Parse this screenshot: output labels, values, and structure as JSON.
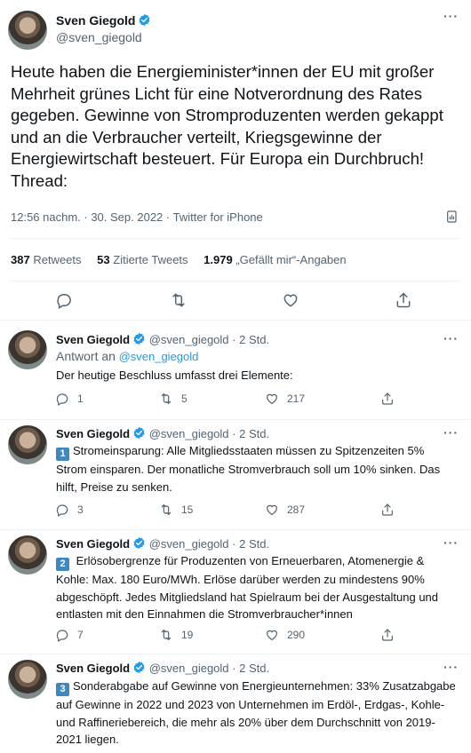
{
  "main_tweet": {
    "author_name": "Sven Giegold",
    "author_handle": "@sven_giegold",
    "text": "Heute haben die Energieminister*innen der EU mit großer Mehrheit grünes Licht für eine Notverordnung des Rates gegeben. Gewinne von Stromproduzenten werden gekappt und an die Verbraucher verteilt, Kriegsgewinne der Energiewirtschaft besteuert. Für Europa ein Durchbruch! Thread:",
    "timestamp": "12:56 nachm. · 30. Sep. 2022 · Twitter for iPhone",
    "retweets_count": "387",
    "retweets_label": "Retweets",
    "quotes_count": "53",
    "quotes_label": "Zitierte Tweets",
    "likes_count": "1.979",
    "likes_label": "„Gefällt mir“-Angaben"
  },
  "replies": [
    {
      "name": "Sven Giegold",
      "handle": "@sven_giegold",
      "time": "· 2 Std.",
      "reply_to_label": "Antwort an",
      "reply_to_handle": "@sven_giegold",
      "badge": "",
      "text": "Der heutige Beschluss umfasst drei Elemente:",
      "replies": "1",
      "retweets": "5",
      "likes": "217"
    },
    {
      "name": "Sven Giegold",
      "handle": "@sven_giegold",
      "time": "· 2 Std.",
      "badge": "1",
      "text": "Stromeinsparung: Alle Mitgliedsstaaten müssen zu Spitzenzeiten 5% Strom einsparen. Der monatliche Stromverbrauch soll um 10% sinken. Das hilft, Preise zu senken.",
      "replies": "3",
      "retweets": "15",
      "likes": "287"
    },
    {
      "name": "Sven Giegold",
      "handle": "@sven_giegold",
      "time": "· 2 Std.",
      "badge": "2",
      "text": " Erlösobergrenze für Produzenten von Erneuerbaren, Atomenergie & Kohle: Max. 180 Euro/MWh. Erlöse darüber werden zu mindestens 90% abgeschöpft. Jedes Mitgliedsland hat Spielraum bei der Ausgestaltung und entlasten mit den Einnahmen die Stromverbraucher*innen",
      "replies": "7",
      "retweets": "19",
      "likes": "290"
    },
    {
      "name": "Sven Giegold",
      "handle": "@sven_giegold",
      "time": "· 2 Std.",
      "badge": "3",
      "text": "Sonderabgabe auf Gewinne von Energieunternehmen: 33% Zusatzabgabe auf Gewinne in 2022 und 2023 von Unternehmen im Erdöl-, Erdgas-, Kohle- und Raffineriebereich, die mehr als 20% über dem Durchschnitt von 2019-2021 liegen."
    }
  ],
  "icons": {
    "verified": "verified-badge-icon",
    "more": "more-icon",
    "reply": "reply-icon",
    "retweet": "retweet-icon",
    "like": "heart-icon",
    "share": "share-icon",
    "analytics": "analytics-icon"
  },
  "colors": {
    "accent": "#1d9bf0",
    "text": "#0f1419",
    "secondary": "#536471",
    "divider": "#eff3f4",
    "keycap": "#3b88c3"
  }
}
